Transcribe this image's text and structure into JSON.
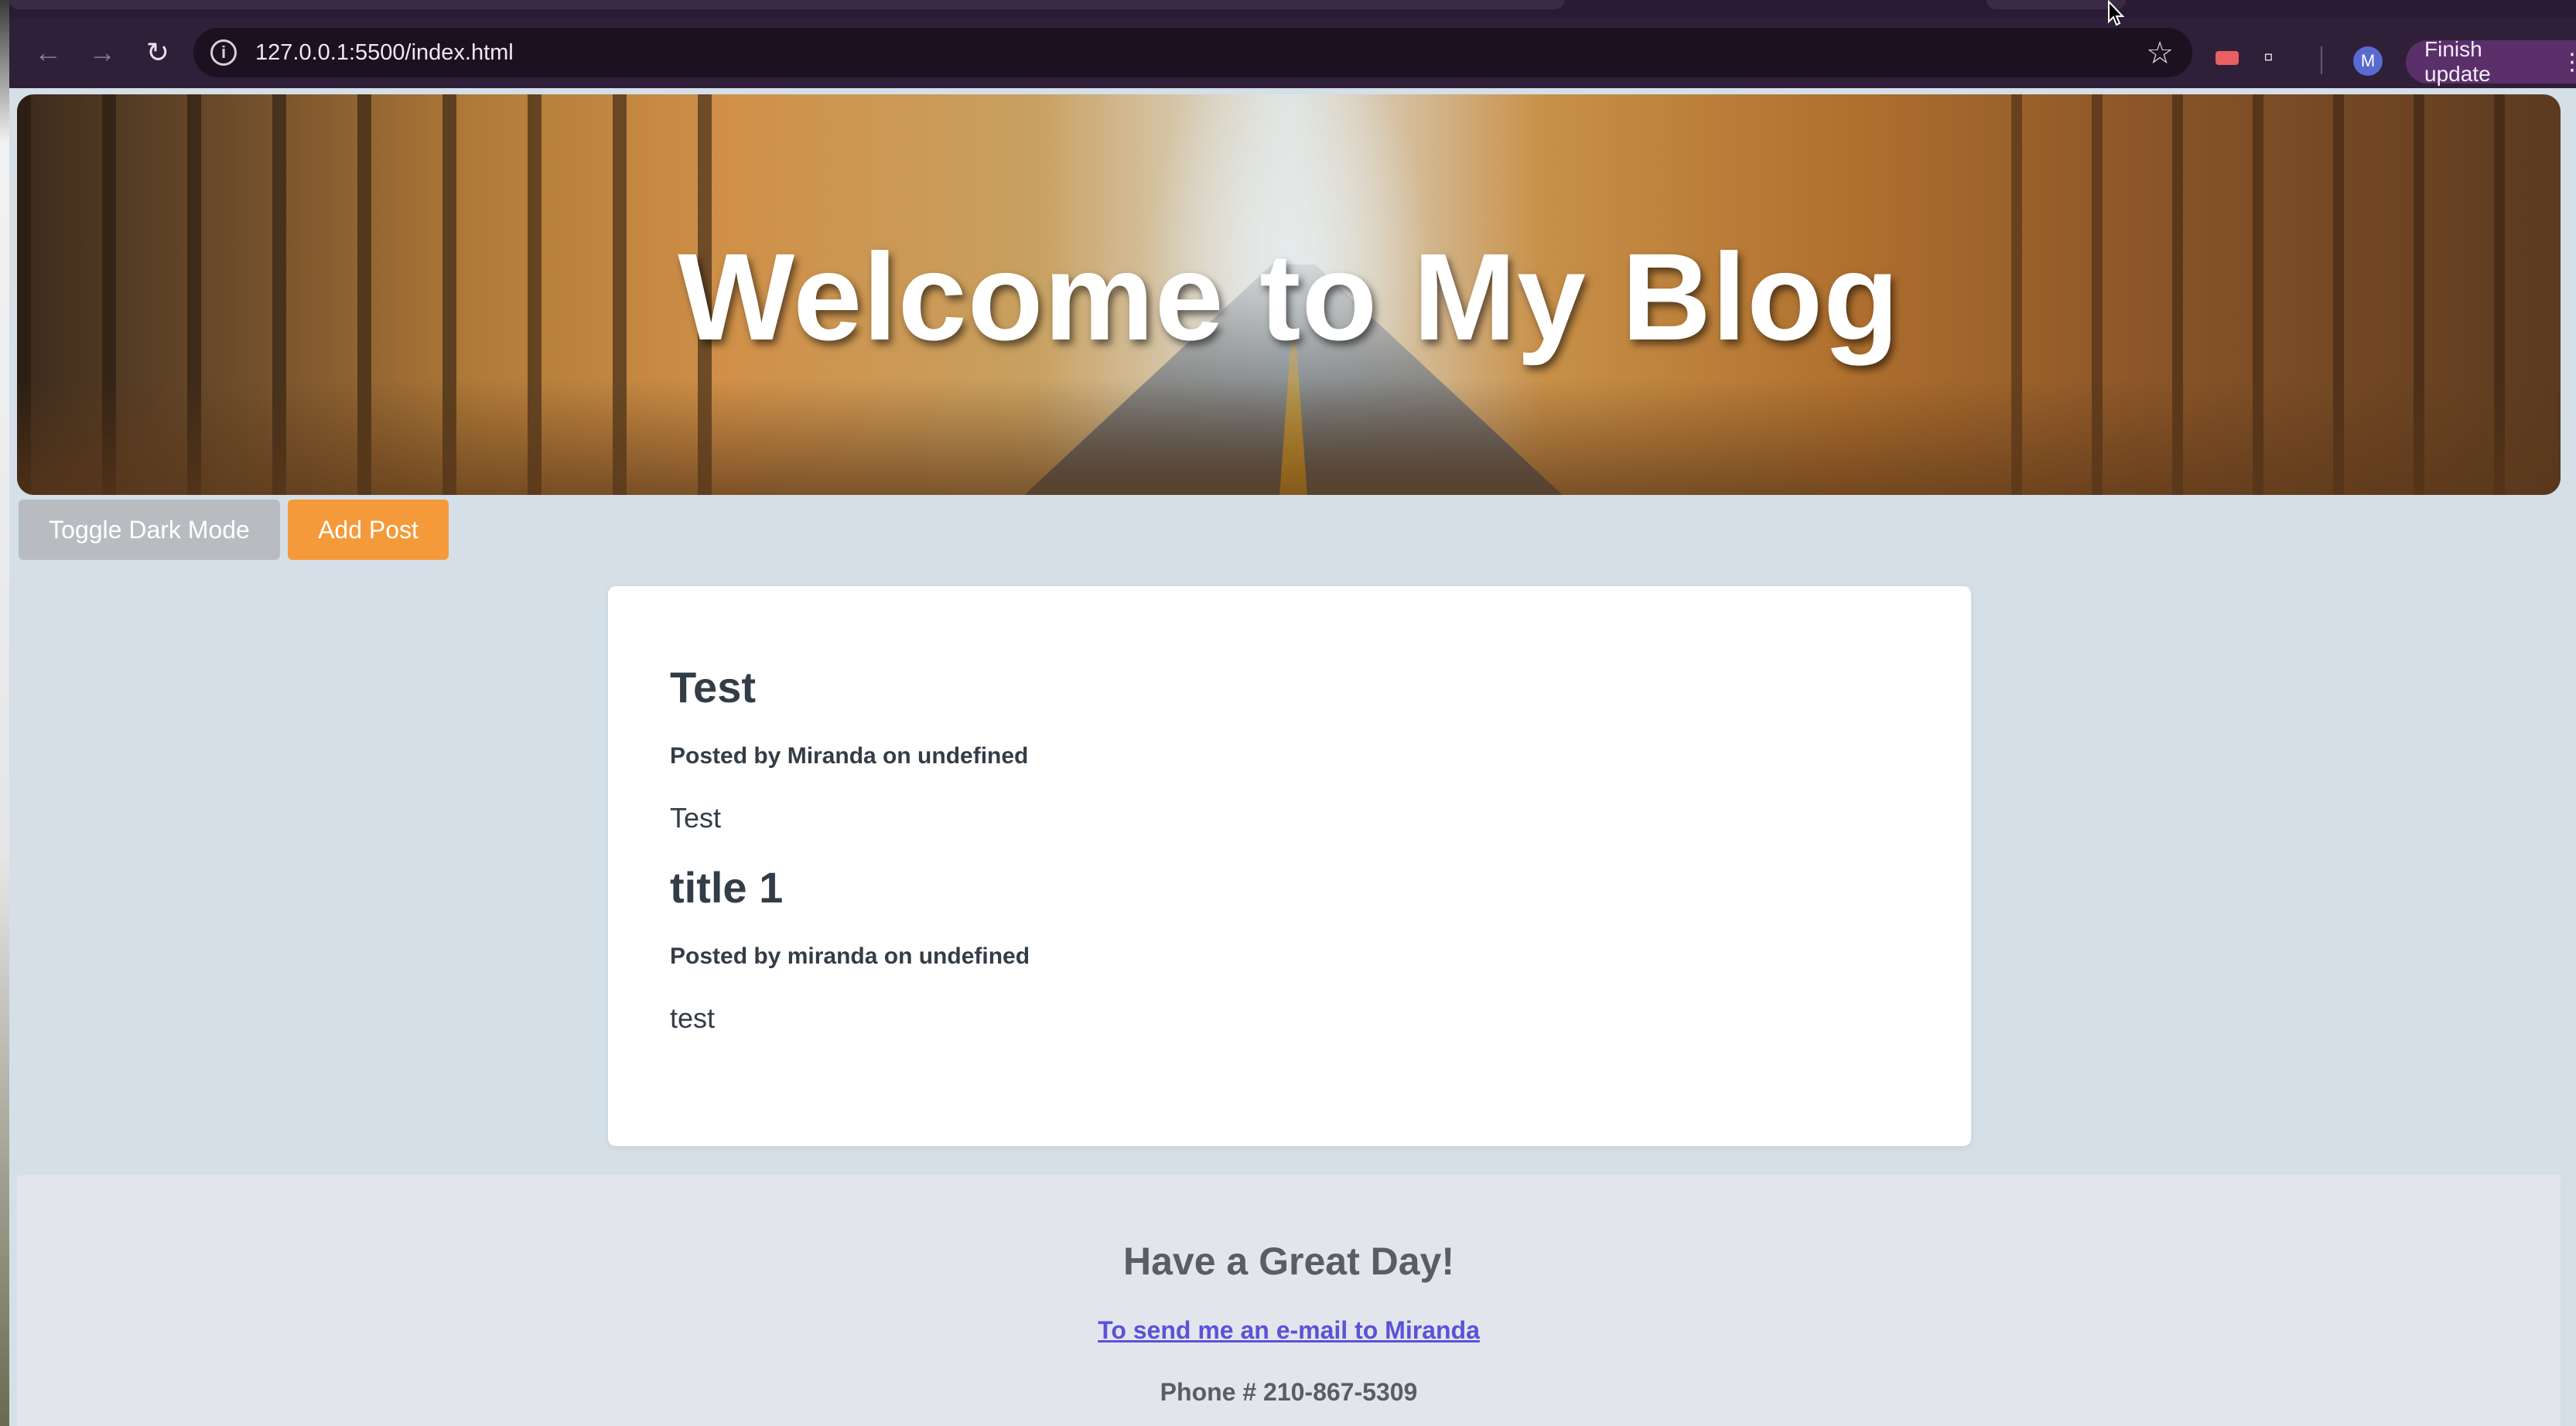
{
  "browser": {
    "url": "127.0.0.1:5500/index.html",
    "finish_update_label": "Finish update",
    "profile_initial": "M",
    "icons": {
      "back": "arrow-left-icon",
      "forward": "arrow-right-icon",
      "reload": "reload-icon",
      "site_info": "info-icon",
      "bookmark": "star-icon",
      "extensions": "puzzle-icon",
      "menu": "kebab-menu-icon"
    }
  },
  "hero": {
    "title": "Welcome to My Blog"
  },
  "controls": {
    "toggle_dark_mode_label": "Toggle Dark Mode",
    "add_post_label": "Add Post",
    "toggle_color": "#b8bcc0",
    "add_post_color": "#f59a3a"
  },
  "posts": [
    {
      "title": "Test",
      "meta": "Posted by Miranda on undefined",
      "body": "Test"
    },
    {
      "title": "title 1",
      "meta": "Posted by miranda on undefined",
      "body": "test"
    }
  ],
  "footer": {
    "heading": "Have a Great Day!",
    "email_link": "To send me an e-mail to Miranda",
    "phone": "Phone # 210-867-5309",
    "link_color": "#5a52d8"
  }
}
